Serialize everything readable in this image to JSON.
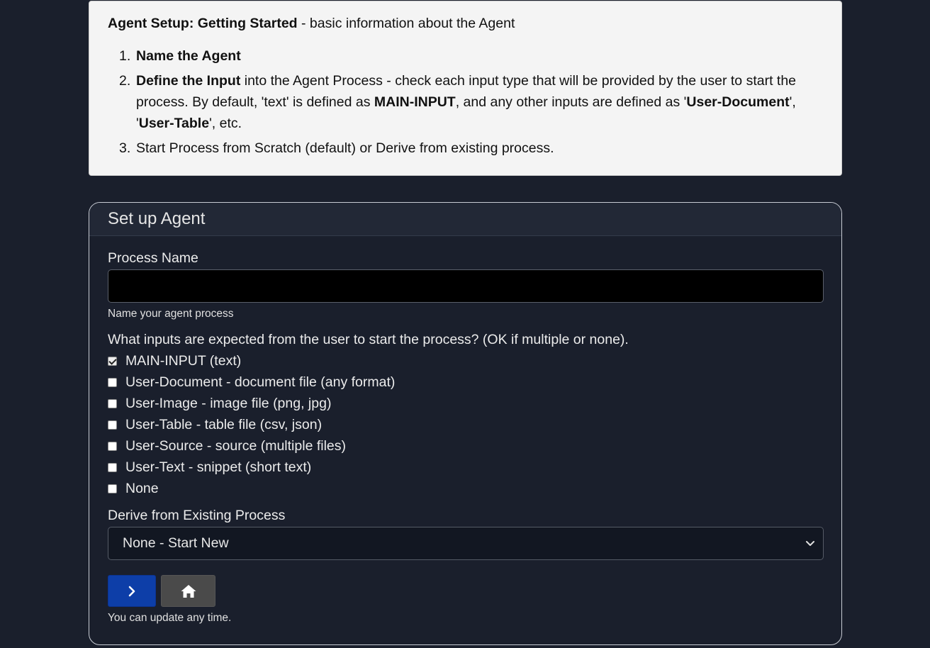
{
  "info": {
    "title_bold": "Agent Setup: Getting Started",
    "title_rest": " - basic information about the Agent",
    "steps": [
      {
        "num": "1.",
        "bold": "Name the Agent"
      },
      {
        "num": "2.",
        "bold": "Define the Input",
        "t1": " into the Agent Process - check each input type that will be provided by the user to start the process. By default, 'text' is defined as ",
        "b2": "MAIN-INPUT",
        "t2": ", and any other inputs are defined as '",
        "b3": "User-Document",
        "t3": "', '",
        "b4": "User-Table",
        "t4": "', etc."
      },
      {
        "num": "3.",
        "text": "Start Process from Scratch (default) or Derive from existing process."
      }
    ]
  },
  "form": {
    "header": "Set up Agent",
    "process_name_label": "Process Name",
    "process_name_value": "",
    "process_name_hint": "Name your agent process",
    "inputs_question": "What inputs are expected from the user to start the process? (OK if multiple or none).",
    "inputs": [
      {
        "label": "MAIN-INPUT (text)",
        "checked": true
      },
      {
        "label": "User-Document - document file (any format)",
        "checked": false
      },
      {
        "label": "User-Image - image file (png, jpg)",
        "checked": false
      },
      {
        "label": "User-Table - table file (csv, json)",
        "checked": false
      },
      {
        "label": "User-Source - source (multiple files)",
        "checked": false
      },
      {
        "label": "User-Text - snippet (short text)",
        "checked": false
      },
      {
        "label": "None",
        "checked": false
      }
    ],
    "derive_label": "Derive from Existing Process",
    "derive_selected": "None - Start New",
    "next_icon": "chevron-right-icon",
    "home_icon": "home-icon",
    "footer_hint": "You can update any time."
  },
  "colors": {
    "background": "#1a1f2c",
    "primary_button": "#0d3ea8",
    "secondary_button": "#4a4a4a",
    "info_box": "#f4f4f4"
  }
}
